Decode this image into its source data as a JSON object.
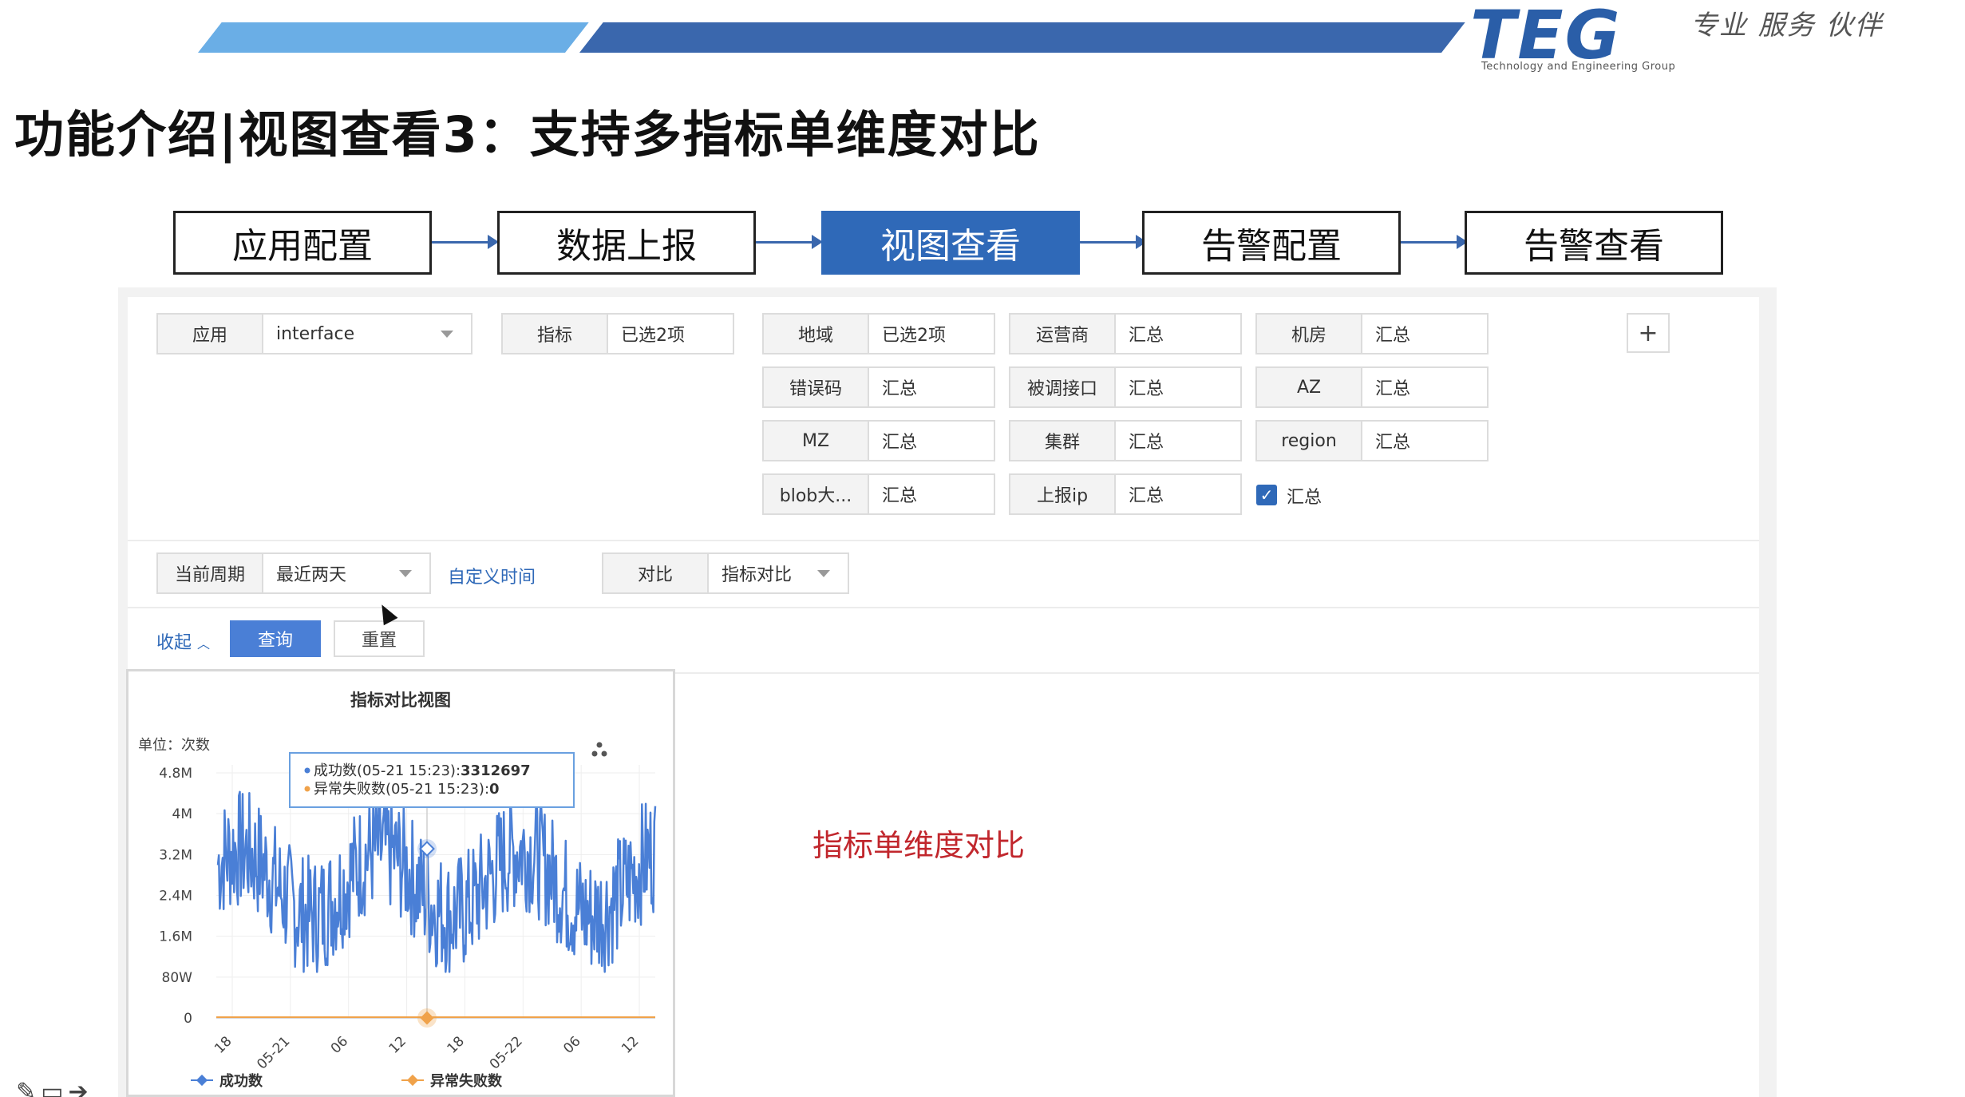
{
  "header": {
    "logo": "TEG",
    "logo_subtitle": "Technology and Engineering Group",
    "slogan": "专业 服务 伙伴",
    "title": "功能介绍|视图查看3：支持多指标单维度对比"
  },
  "flow": {
    "steps": [
      {
        "label": "应用配置",
        "active": false
      },
      {
        "label": "数据上报",
        "active": false
      },
      {
        "label": "视图查看",
        "active": true
      },
      {
        "label": "告警配置",
        "active": false
      },
      {
        "label": "告警查看",
        "active": false
      }
    ]
  },
  "filters": {
    "app": {
      "label": "应用",
      "value": "interface"
    },
    "metric": {
      "label": "指标",
      "value": "已选2项"
    },
    "dimensions": [
      {
        "label": "地域",
        "value": "已选2项"
      },
      {
        "label": "运营商",
        "value": "汇总"
      },
      {
        "label": "机房",
        "value": "汇总"
      },
      {
        "label": "错误码",
        "value": "汇总"
      },
      {
        "label": "被调接口",
        "value": "汇总"
      },
      {
        "label": "AZ",
        "value": "汇总"
      },
      {
        "label": "MZ",
        "value": "汇总"
      },
      {
        "label": "集群",
        "value": "汇总"
      },
      {
        "label": "region",
        "value": "汇总"
      },
      {
        "label": "blob大...",
        "value": "汇总"
      },
      {
        "label": "上报ip",
        "value": "汇总"
      }
    ],
    "summary_checkbox": {
      "label": "汇总",
      "checked": true
    },
    "add_button": "+"
  },
  "query": {
    "period": {
      "label": "当前周期",
      "value": "最近两天"
    },
    "custom_time_link": "自定义时间",
    "compare": {
      "label": "对比",
      "value": "指标对比"
    },
    "collapse_link": "收起",
    "search_button": "查询",
    "reset_button": "重置"
  },
  "chart": {
    "title": "指标对比视图",
    "unit": "单位：次数",
    "tooltip": {
      "line1_label": "成功数(05-21 15:23):",
      "line1_value": "3312697",
      "line2_label": "异常失败数(05-21 15:23):",
      "line2_value": "0"
    }
  },
  "annotation": "指标单维度对比",
  "colors": {
    "accent": "#2f69b8",
    "series_success": "#4a7fd6",
    "series_fail": "#f0a24a",
    "annotation": "#c1272d"
  },
  "chart_data": {
    "type": "line",
    "title": "指标对比视图",
    "ylabel": "单位：次数",
    "yticks": [
      "0",
      "80W",
      "1.6M",
      "2.4M",
      "3.2M",
      "4M",
      "4.8M"
    ],
    "ylim": [
      0,
      4800000
    ],
    "xticks": [
      "18",
      "05-21",
      "06",
      "12",
      "18",
      "05-22",
      "06",
      "12"
    ],
    "series": [
      {
        "name": "成功数",
        "color": "#4a7fd6",
        "note": "fluctuating between ~0.9M and ~4.6M, tooltip at 05-21 15:23 = 3312697"
      },
      {
        "name": "异常失败数",
        "color": "#f0a24a",
        "note": "flat at 0"
      }
    ],
    "legend": "bottom"
  }
}
